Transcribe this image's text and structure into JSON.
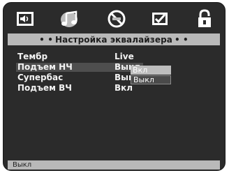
{
  "tabs": [
    {
      "icon": "speaker-icon"
    },
    {
      "icon": "audio-note-icon"
    },
    {
      "icon": "no-smoke-icon"
    },
    {
      "icon": "checkbox-icon"
    },
    {
      "icon": "lock-icon"
    }
  ],
  "title": {
    "dots_left": "• •",
    "text": "Настройка эквалайзера",
    "dots_right": "• •"
  },
  "menu": {
    "items": [
      {
        "label": "Тембр",
        "value": "Live"
      },
      {
        "label": "Подъем НЧ",
        "value": "Выкл"
      },
      {
        "label": "Супербас",
        "value": "Выкл"
      },
      {
        "label": "Подъем ВЧ",
        "value": "Вкл"
      }
    ]
  },
  "options": [
    "Вкл",
    "Выкл"
  ],
  "status": {
    "text": "Выкл"
  },
  "colors": {
    "frame": "#2b2b2b",
    "bar": "#b9b9b9",
    "selected": "#4e4e4e",
    "text": "#f2f2f2"
  }
}
